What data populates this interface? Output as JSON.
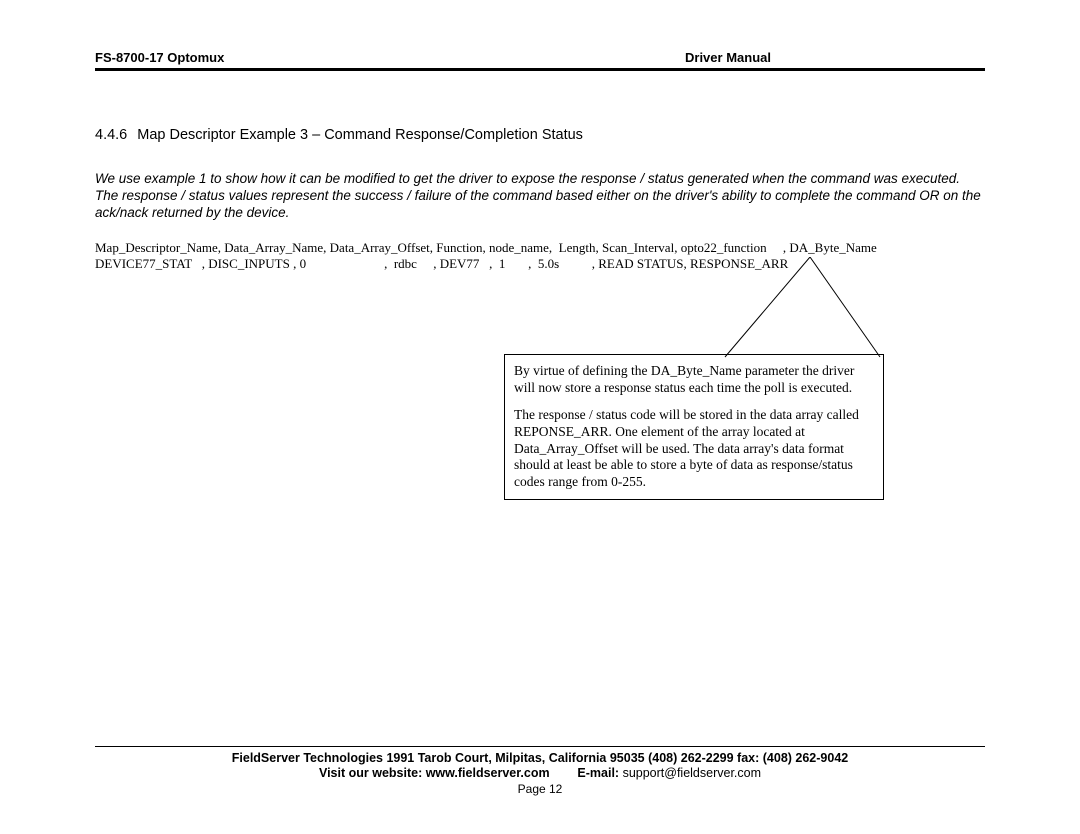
{
  "header": {
    "left": "FS-8700-17 Optomux",
    "right": "Driver Manual"
  },
  "section": {
    "number": "4.4.6",
    "title": "Map Descriptor Example 3 – Command Response/Completion Status"
  },
  "intro": "We use example 1 to show how it can be modified to get the driver to expose the response / status generated when the command was executed. The response / status values represent the success / failure of the command based either on the driver's ability to complete the command OR on the ack/nack returned by the device.",
  "columns": {
    "c0": "Map_Descriptor_Name,",
    "c1": "Data_Array_Name,",
    "c2": "Data_Array_Offset,",
    "c3": "Function,",
    "c4": "node_name,",
    "c5": "Length,",
    "c6": "Scan_Interval,",
    "c7": "opto22_function",
    "c8": ", DA_Byte_Name"
  },
  "row": {
    "c0": "DEVICE77_STAT   ,",
    "c1": " DISC_INPUTS ,",
    "c2": " 0",
    "c3": ",  rdbc",
    "c4": ", DEV77",
    "c5": ",  1",
    "c6": ",  5.0s",
    "c7": ", READ STATUS,",
    "c8": " RESPONSE_ARR"
  },
  "callout": {
    "p1": "By virtue of defining the DA_Byte_Name parameter the driver will now store a response status each time the poll is executed.",
    "p2": "The response / status code will be stored in the data array called REPONSE_ARR. One element of the array located at Data_Array_Offset will be used. The data array's data format should at least be able to store a byte of data as response/status codes range from 0-255."
  },
  "footer": {
    "addr": "FieldServer Technologies 1991 Tarob Court, Milpitas, California 95035 (408) 262-2299 fax: (408) 262-9042",
    "web_label": "Visit our website: www.fieldserver.com",
    "email_label": "E-mail:",
    "email_value": "  support@fieldserver.com",
    "page": "Page 12"
  }
}
